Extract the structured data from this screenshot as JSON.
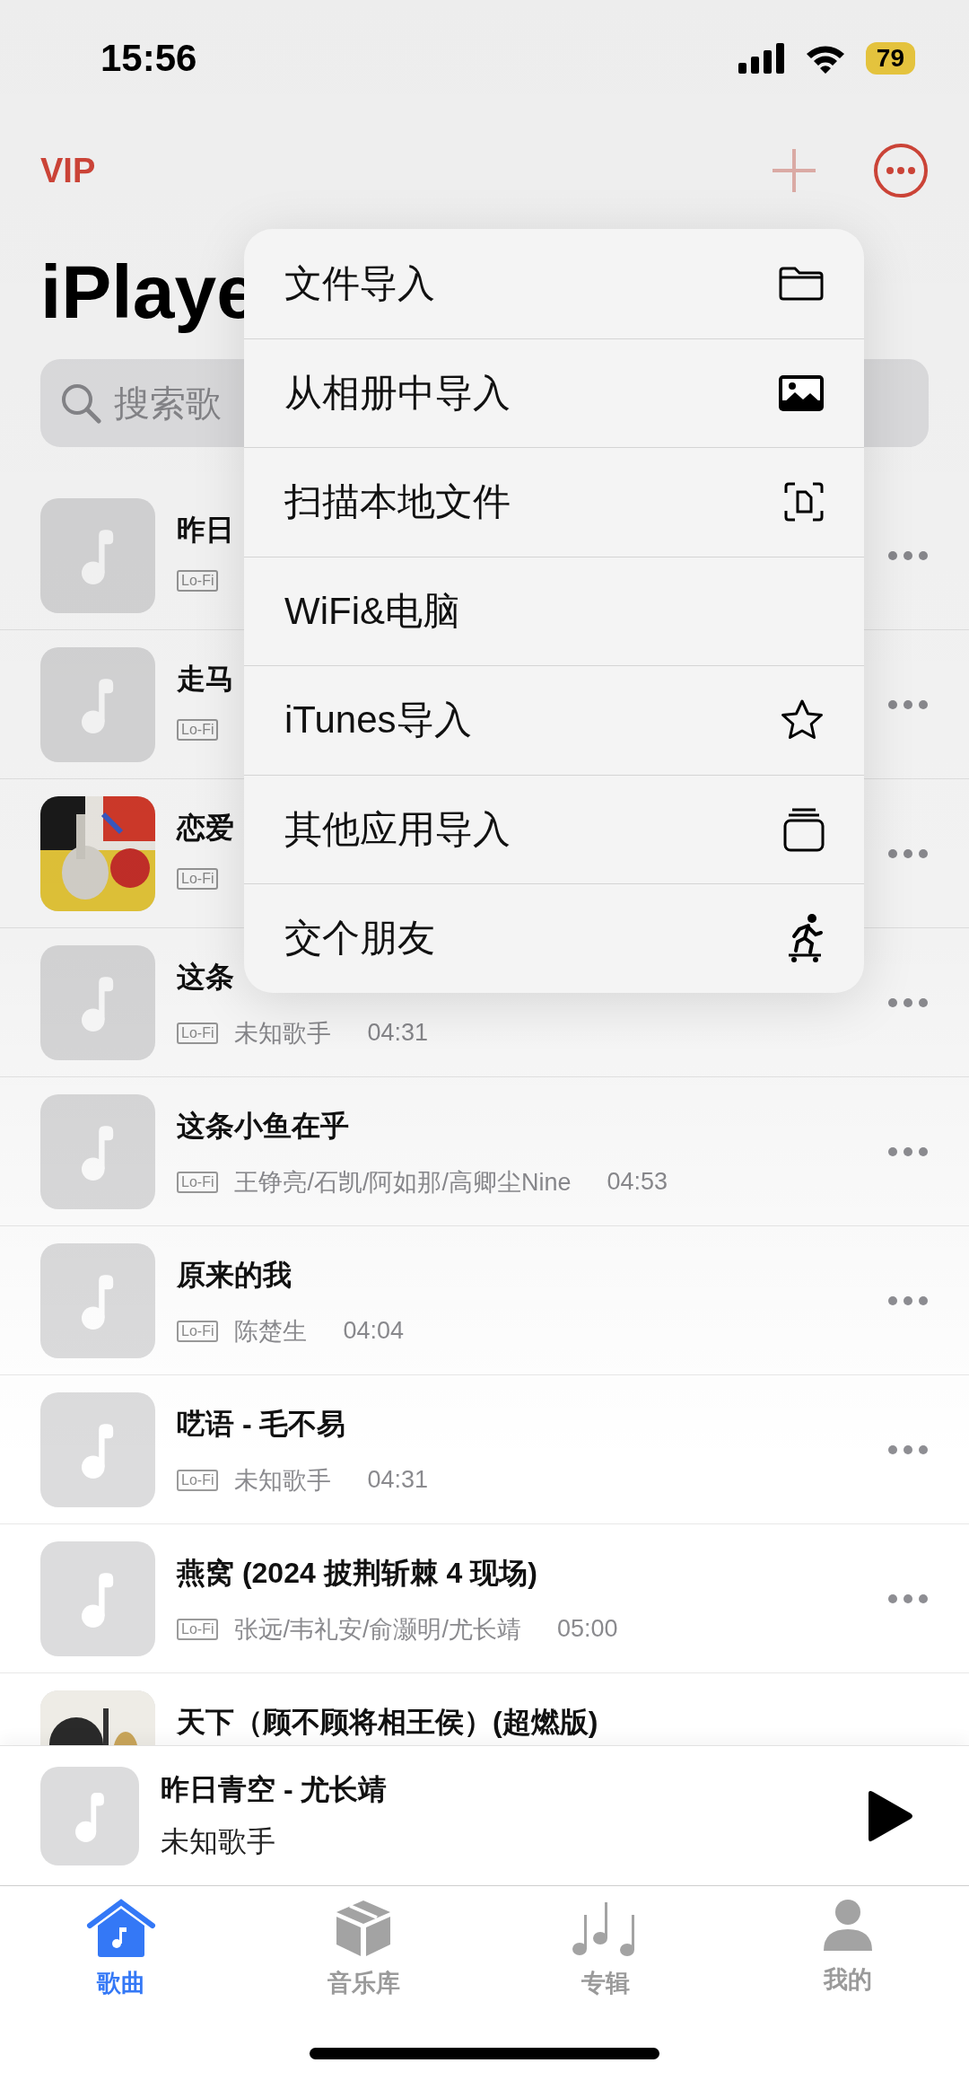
{
  "status_bar": {
    "time": "15:56",
    "battery": "79"
  },
  "header": {
    "vip": "VIP",
    "title": "iPlaye"
  },
  "search": {
    "placeholder": "搜索歌"
  },
  "songs": [
    {
      "title": "昨日",
      "tag": "Lo-Fi",
      "kind": "placeholder"
    },
    {
      "title": "走马",
      "tag": "Lo-Fi",
      "kind": "placeholder"
    },
    {
      "title": "恋爱",
      "tag": "Lo-Fi",
      "kind": "picture"
    },
    {
      "title": "这条",
      "tag": "Lo-Fi",
      "artist": "未知歌手",
      "duration": "04:31",
      "kind": "placeholder"
    },
    {
      "title": "这条小鱼在乎",
      "tag": "Lo-Fi",
      "artist": "王铮亮/石凯/阿如那/高卿尘Nine",
      "duration": "04:53",
      "kind": "placeholder"
    },
    {
      "title": "原来的我",
      "tag": "Lo-Fi",
      "artist": "陈楚生",
      "duration": "04:04",
      "kind": "placeholder"
    },
    {
      "title": "呓语 - 毛不易",
      "tag": "Lo-Fi",
      "artist": "未知歌手",
      "duration": "04:31",
      "kind": "placeholder"
    },
    {
      "title": "燕窝 (2024 披荆斩棘 4 现场)",
      "tag": "Lo-Fi",
      "artist": "张远/韦礼安/俞灏明/尤长靖",
      "duration": "05:00",
      "kind": "placeholder"
    },
    {
      "title": "天下（顾不顾将相王侯）(超燃版)",
      "kind": "picture"
    }
  ],
  "menu": [
    {
      "label": "文件导入"
    },
    {
      "label": "从相册中导入"
    },
    {
      "label": "扫描本地文件"
    },
    {
      "label": "WiFi&电脑"
    },
    {
      "label": "iTunes导入"
    },
    {
      "label": "其他应用导入"
    },
    {
      "label": "交个朋友"
    }
  ],
  "now_playing": {
    "title": "昨日青空 - 尤长靖",
    "artist": "未知歌手"
  },
  "tabs": [
    {
      "label": "歌曲",
      "selected": true
    },
    {
      "label": "音乐库",
      "selected": false
    },
    {
      "label": "专辑",
      "selected": false
    },
    {
      "label": "我的",
      "selected": false
    }
  ]
}
